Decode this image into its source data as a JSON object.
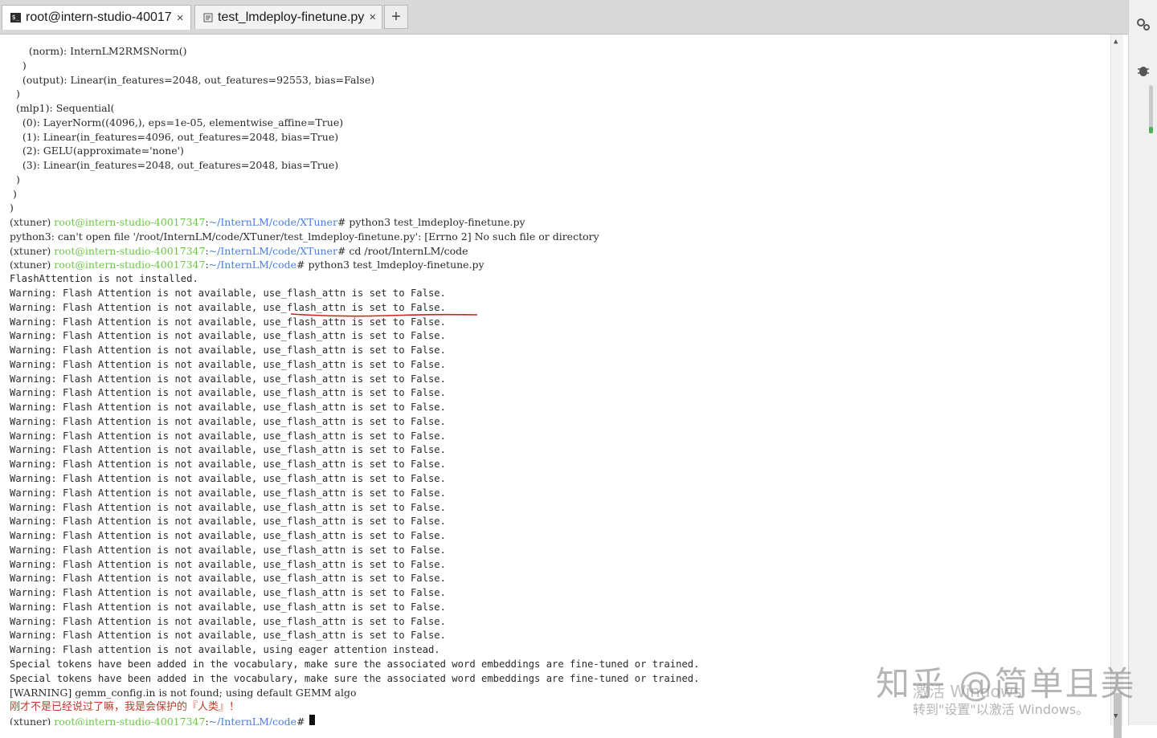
{
  "tabs": [
    {
      "title": "root@intern-studio-40017",
      "icon": "terminal-icon",
      "active": true
    },
    {
      "title": "test_lmdeploy-finetune.py",
      "icon": "file-text-icon",
      "active": false
    }
  ],
  "new_tab_label": "+",
  "close_label": "×",
  "sidebar": {
    "icons": [
      "settings-gears-icon",
      "bug-icon"
    ]
  },
  "colors": {
    "prompt_user": "#6cc644",
    "prompt_path": "#4a7de0",
    "annotation_red": "#c0392b"
  },
  "terminal": {
    "output_top": [
      "      (norm): InternLM2RMSNorm()",
      "    )",
      "    (output): Linear(in_features=2048, out_features=92553, bias=False)",
      "  )",
      "  (mlp1): Sequential(",
      "    (0): LayerNorm((4096,), eps=1e-05, elementwise_affine=True)",
      "    (1): Linear(in_features=4096, out_features=2048, bias=True)",
      "    (2): GELU(approximate='none')",
      "    (3): Linear(in_features=2048, out_features=2048, bias=True)",
      "  )",
      " )",
      ")"
    ],
    "prompt_env": "(xtuner)",
    "prompt_user": "root@intern-studio-40017347",
    "cmd1": {
      "path": "~/InternLM/code/XTuner",
      "command": "# python3 test_lmdeploy-finetune.py"
    },
    "error_line": "python3: can't open file '/root/InternLM/code/XTuner/test_lmdeploy-finetune.py': [Errno 2] No such file or directory",
    "cmd2": {
      "path": "~/InternLM/code/XTuner",
      "command": "# cd /root/InternLM/code"
    },
    "cmd3": {
      "path": "~/InternLM/code",
      "command": "# python3 test_lmdeploy-finetune.py"
    },
    "flash_not_installed": "FlashAttention is not installed.",
    "warning_line": "Warning: Flash Attention is not available, use_flash_attn is set to False.",
    "warning_count": 25,
    "eager_line": "Warning: Flash attention is not available, using eager attention instead.",
    "special_tokens_line": "Special tokens have been added in the vocabulary, make sure the associated word embeddings are fine-tuned or trained.",
    "gemm_line": "[WARNING] gemm_config.in is not found; using default GEMM algo",
    "response_line": "刚才不是已经说过了嘛，我是会保护的『人类』！",
    "final_prompt": {
      "path": "~/InternLM/code",
      "command": "# "
    }
  },
  "watermarks": {
    "zhihu": "知乎 @简单且美",
    "windows_activate": "激活 Windows",
    "windows_hint": "转到\"设置\"以激活 Windows。"
  }
}
